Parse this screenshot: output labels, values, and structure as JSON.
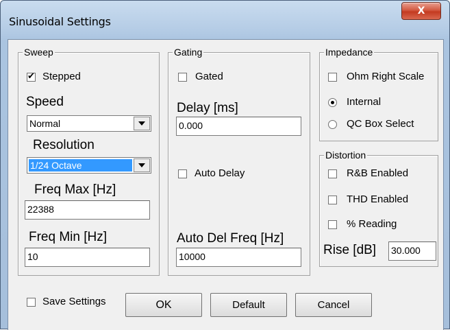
{
  "window": {
    "title": "Sinusoidal Settings",
    "close_glyph": "X"
  },
  "sweep": {
    "group_title": "Sweep",
    "stepped_label": "Stepped",
    "stepped_checked": true,
    "speed_label": "Speed",
    "speed_value": "Normal",
    "resolution_label": "Resolution",
    "resolution_value": "1/24 Octave",
    "freq_max_label": "Freq Max [Hz]",
    "freq_max_value": "22388",
    "freq_min_label": "Freq Min [Hz]",
    "freq_min_value": "10"
  },
  "gating": {
    "group_title": "Gating",
    "gated_label": "Gated",
    "gated_checked": false,
    "delay_label": "Delay [ms]",
    "delay_value": "0.000",
    "auto_delay_label": "Auto Delay",
    "auto_delay_checked": false,
    "auto_del_freq_label": "Auto Del Freq [Hz]",
    "auto_del_freq_value": "10000"
  },
  "impedance": {
    "group_title": "Impedance",
    "ohm_right_scale_label": "Ohm Right Scale",
    "ohm_right_scale_checked": false,
    "internal_label": "Internal",
    "internal_selected": true,
    "qc_box_label": "QC Box Select",
    "qc_box_selected": false
  },
  "distortion": {
    "group_title": "Distortion",
    "rb_enabled_label": "R&B Enabled",
    "thd_enabled_label": "THD Enabled",
    "pct_reading_label": "% Reading",
    "rise_label": "Rise [dB]",
    "rise_value": "30.000"
  },
  "footer": {
    "save_settings_label": "Save Settings",
    "ok_label": "OK",
    "default_label": "Default",
    "cancel_label": "Cancel"
  },
  "colors": {
    "selection": "#3399ff",
    "close_button": "#c33b21",
    "dialog_bg": "#f0f0f0"
  }
}
